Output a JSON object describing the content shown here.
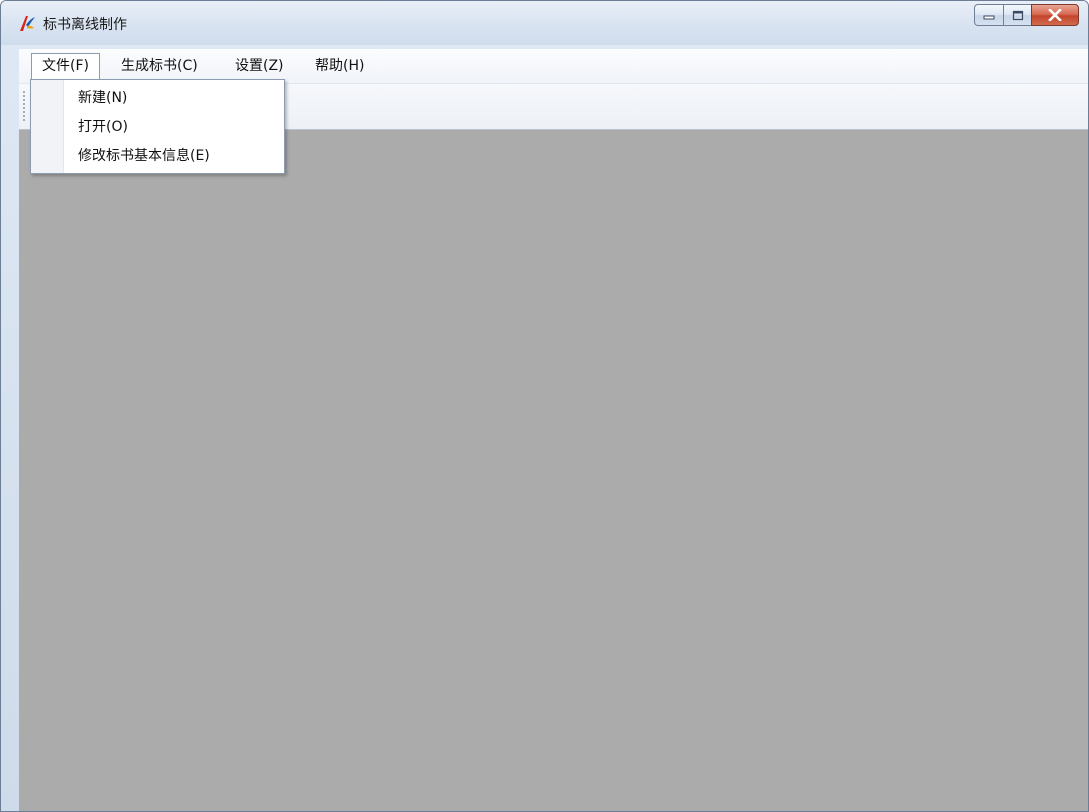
{
  "window": {
    "title": "标书离线制作",
    "icon": "app-logo-icon"
  },
  "window_controls": {
    "minimize_icon": "minimize-icon",
    "maximize_icon": "maximize-icon",
    "close_icon": "close-icon",
    "close_color": "#c3452b"
  },
  "menubar": {
    "items": [
      {
        "label": "文件(F)"
      },
      {
        "label": "生成标书(C)"
      },
      {
        "label": "设置(Z)"
      },
      {
        "label": "帮助(H)"
      }
    ]
  },
  "file_menu": {
    "items": [
      {
        "label": "新建(N)"
      },
      {
        "label": "打开(O)"
      },
      {
        "label": "修改标书基本信息(E)"
      }
    ]
  },
  "colors": {
    "workspace": "#ababab",
    "menu_border": "#8d9bb0"
  }
}
